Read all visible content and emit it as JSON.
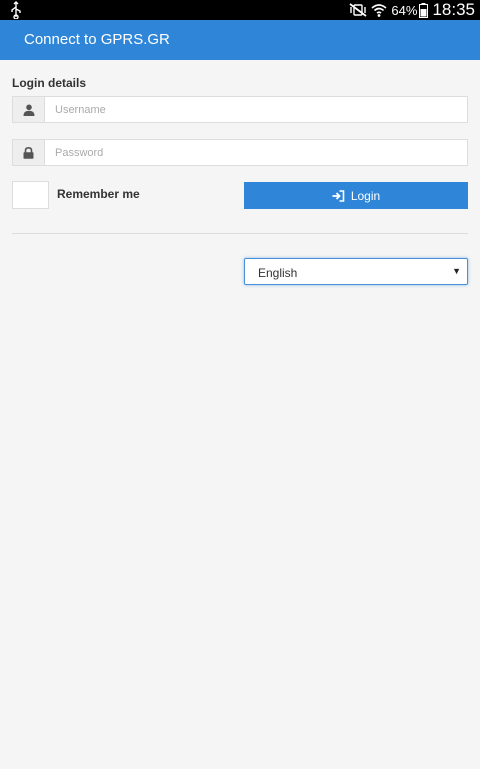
{
  "status_bar": {
    "battery_percent": "64%",
    "time": "18:35",
    "icons": [
      "usb-icon",
      "mute-vibrate-icon",
      "wifi-icon",
      "battery-icon"
    ]
  },
  "app_bar": {
    "title": "Connect to GPRS.GR",
    "color": "#2f86d8"
  },
  "login_form": {
    "section_label": "Login details",
    "username": {
      "value": "",
      "placeholder": "Username",
      "icon": "user-icon"
    },
    "password": {
      "value": "",
      "placeholder": "Password",
      "icon": "lock-icon"
    },
    "remember_me": {
      "label": "Remember me",
      "checked": false
    },
    "login_button": {
      "label": "Login",
      "icon": "sign-in-icon"
    }
  },
  "language_select": {
    "selected": "English"
  }
}
